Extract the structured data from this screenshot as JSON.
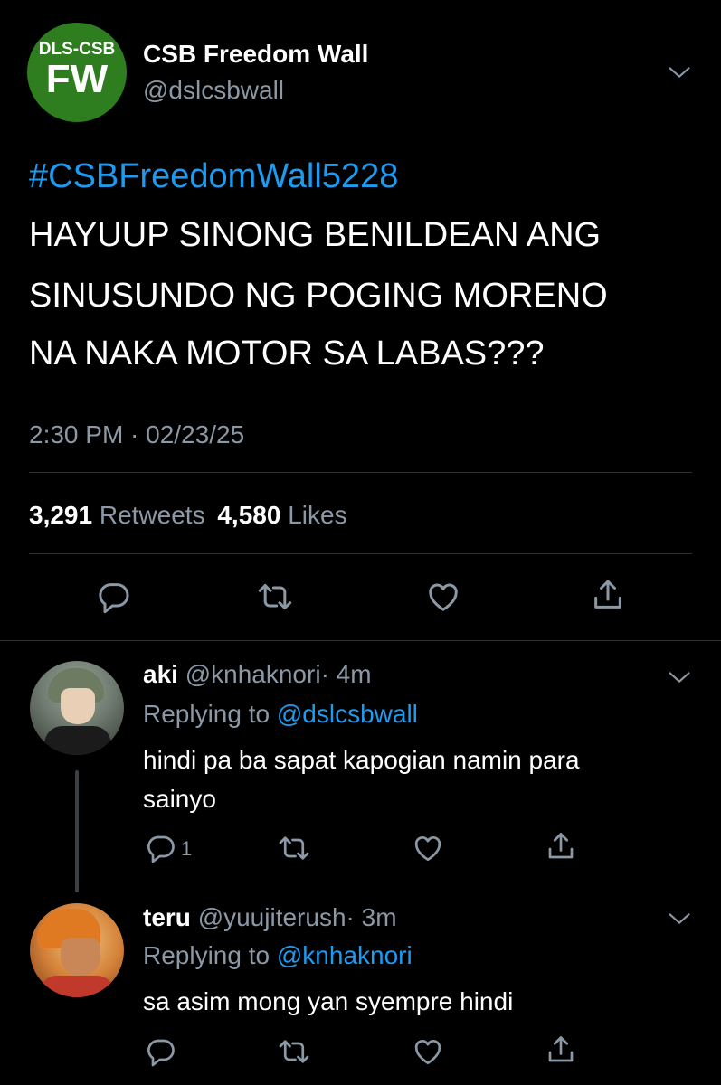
{
  "tweet": {
    "avatar": {
      "line1": "DLS-CSB",
      "line2": "FW"
    },
    "display_name": "CSB Freedom Wall",
    "handle": "@dslcsbwall",
    "hashtag": "#CSBFreedomWall5228",
    "text_lines": [
      "HAYUUP SINONG BENILDEAN ANG",
      "SINUSUNDO NG POGING MORENO",
      "NA NAKA MOTOR SA LABAS???"
    ],
    "timestamp": "2:30 PM · 02/23/25",
    "retweets_count": "3,291",
    "retweets_label": "Retweets",
    "likes_count": "4,580",
    "likes_label": "Likes"
  },
  "replies": [
    {
      "name": "aki",
      "handle": "@knhaknori",
      "time": "· 4m",
      "replying_label": "Replying to",
      "replying_to": "@dslcsbwall",
      "text_lines": [
        "hindi pa ba sapat kapogian namin para",
        "sainyo"
      ],
      "reply_count": "1"
    },
    {
      "name": "teru",
      "handle": "@yuujiterush",
      "time": "· 3m",
      "replying_label": "Replying to",
      "replying_to": "@knhaknori",
      "text_lines": [
        "sa asim mong yan syempre hindi"
      ],
      "reply_count": ""
    }
  ],
  "colors": {
    "background": "#000000",
    "secondary_text": "#8b98a5",
    "link": "#1d9bf0",
    "divider": "#2f3336",
    "avatar_green": "#2e7d1f"
  }
}
